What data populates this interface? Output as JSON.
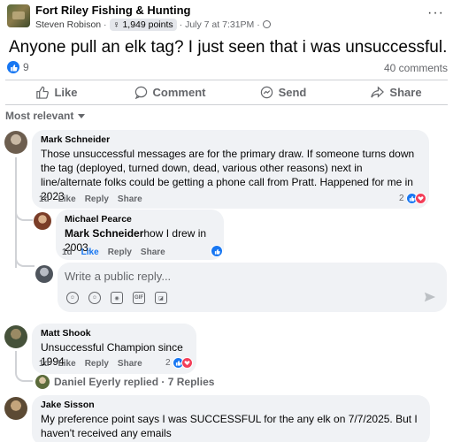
{
  "post": {
    "group_name": "Fort Riley Fishing & Hunting",
    "author": "Steven Robison",
    "points": "1,949 points",
    "timestamp": "July 7 at 7:31PM",
    "text": "Anyone pull an elk tag? I just seen that i was unsuccessful.",
    "reaction_count": "9",
    "comment_count": "40 comments"
  },
  "actions": {
    "like": "Like",
    "comment": "Comment",
    "send": "Send",
    "share": "Share"
  },
  "sort_label": "Most relevant",
  "comments": [
    {
      "name": "Mark Schneider",
      "text": "Those unsuccessful messages are for the primary draw. If someone turns down the tag (deployed, turned down, dead, various other reasons) next in line/alternate folks could be getting a phone call from Pratt. Happened for me in 2023",
      "age": "1d",
      "like": "Like",
      "reply": "Reply",
      "share": "Share",
      "reactions": "2"
    },
    {
      "name": "Matt Shook",
      "text": "Unsuccessful Champion since 1994",
      "age": "1d",
      "like": "Like",
      "reply": "Reply",
      "share": "Share",
      "reactions": "2"
    },
    {
      "name": "Jake Sisson",
      "text": "My preference point says I was SUCCESSFUL for the any elk on 7/7/2025. But I haven't received any emails"
    }
  ],
  "reply": {
    "name": "Michael Pearce",
    "mention": "Mark Schneider",
    "text": "how I drew in 2003.",
    "age": "1d",
    "like": "Like",
    "reply": "Reply",
    "share": "Share"
  },
  "composer": {
    "placeholder": "Write a public reply..."
  },
  "replies_link": "Daniel Eyerly replied · 7 Replies",
  "colors": {
    "accent": "#1877f2",
    "love": "#f33e58",
    "bubble": "#f0f2f5",
    "muted_text": "#65676b"
  }
}
